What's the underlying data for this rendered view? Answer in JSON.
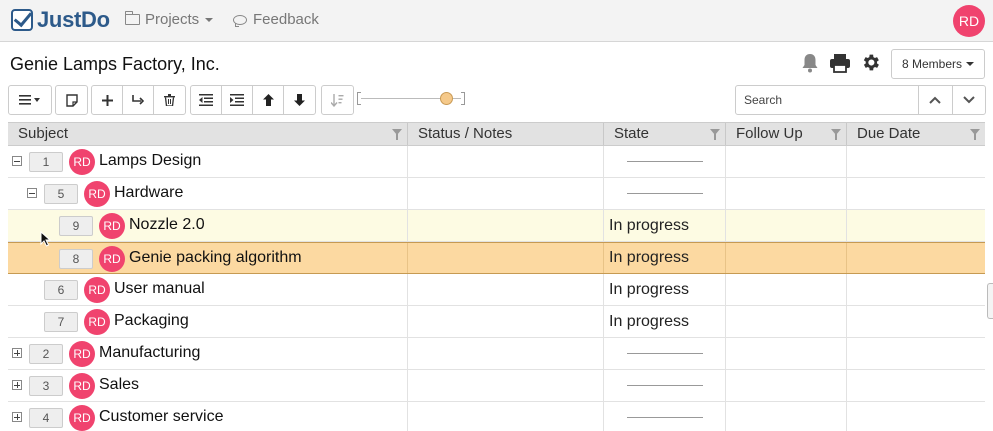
{
  "app": {
    "brand": "JustDo",
    "avatar_initials": "RD"
  },
  "nav": {
    "projects_label": "Projects",
    "feedback_label": "Feedback"
  },
  "project": {
    "title": "Genie Lamps Factory, Inc.",
    "members_label": "8 Members"
  },
  "search": {
    "placeholder": "Search"
  },
  "grid": {
    "columns": [
      "Subject",
      "Status / Notes",
      "State",
      "Follow Up",
      "Due Date"
    ],
    "rows": [
      {
        "seq": "1",
        "owner": "RD",
        "title": "Lamps Design",
        "state": "",
        "expander": "minus",
        "level": 0
      },
      {
        "seq": "5",
        "owner": "RD",
        "title": "Hardware",
        "state": "",
        "expander": "minus",
        "level": 1
      },
      {
        "seq": "9",
        "owner": "RD",
        "title": "Nozzle 2.0",
        "state": "In progress",
        "expander": "none",
        "level": 2
      },
      {
        "seq": "8",
        "owner": "RD",
        "title": "Genie packing algorithm",
        "state": "In progress",
        "expander": "none",
        "level": 2
      },
      {
        "seq": "6",
        "owner": "RD",
        "title": "User manual",
        "state": "In progress",
        "expander": "none",
        "level": 1
      },
      {
        "seq": "7",
        "owner": "RD",
        "title": "Packaging",
        "state": "In progress",
        "expander": "none",
        "level": 1
      },
      {
        "seq": "2",
        "owner": "RD",
        "title": "Manufacturing",
        "state": "",
        "expander": "plus",
        "level": 0
      },
      {
        "seq": "3",
        "owner": "RD",
        "title": "Sales",
        "state": "",
        "expander": "plus",
        "level": 0
      },
      {
        "seq": "4",
        "owner": "RD",
        "title": "Customer service",
        "state": "",
        "expander": "plus",
        "level": 0
      }
    ]
  },
  "colors": {
    "brand": "#2d5a8a",
    "avatar": "#f0436e",
    "selected_row": "#fcd9a1",
    "hover_row": "#fdfbe3"
  },
  "icons": [
    "folder-icon",
    "chat-bubble-icon",
    "bell-icon",
    "print-icon",
    "gear-icon",
    "align-dropdown-icon",
    "note-icon",
    "plus-icon",
    "redirect-icon",
    "trash-icon",
    "outdent-icon",
    "indent-icon",
    "arrow-up-icon",
    "arrow-down-icon",
    "sort-icon",
    "filter-icon",
    "chevron-up-icon",
    "chevron-down-icon"
  ]
}
